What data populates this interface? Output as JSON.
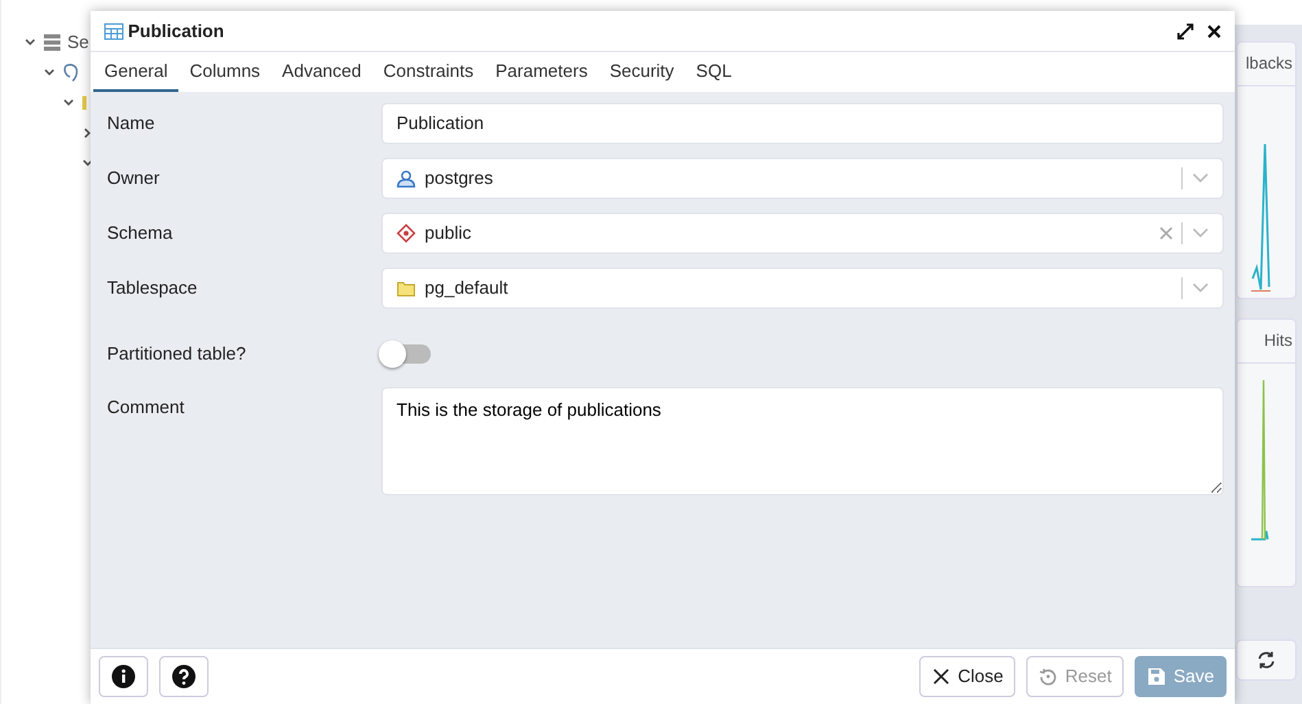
{
  "background": {
    "tree": [
      {
        "label": "Se",
        "expanded": true,
        "children": [
          {
            "expanded": true,
            "children": [
              {
                "expanded": true,
                "children": [
                  {
                    "expanded": false
                  },
                  {
                    "expanded": true
                  }
                ]
              }
            ]
          }
        ]
      }
    ],
    "panels": [
      {
        "title": "lbacks"
      },
      {
        "title": "Hits"
      }
    ]
  },
  "dialog": {
    "title": "Publication",
    "tabs": [
      {
        "label": "General",
        "selected": true
      },
      {
        "label": "Columns",
        "selected": false
      },
      {
        "label": "Advanced",
        "selected": false
      },
      {
        "label": "Constraints",
        "selected": false
      },
      {
        "label": "Parameters",
        "selected": false
      },
      {
        "label": "Security",
        "selected": false
      },
      {
        "label": "SQL",
        "selected": false
      }
    ],
    "fields": [
      {
        "kind": "text",
        "label": "Name",
        "value": "Publication"
      },
      {
        "kind": "role",
        "label": "Owner",
        "value": "postgres",
        "clearable": false
      },
      {
        "kind": "schema",
        "label": "Schema",
        "value": "public",
        "clearable": true
      },
      {
        "kind": "tablespace",
        "label": "Tablespace",
        "value": "pg_default",
        "clearable": false
      },
      {
        "kind": "switch",
        "label": "Partitioned table?",
        "on": false
      },
      {
        "kind": "textarea",
        "label": "Comment",
        "value": "This is the storage of publications"
      }
    ],
    "footer_buttons": [
      {
        "kind": "close",
        "label": "Close",
        "disabled": false
      },
      {
        "kind": "reset",
        "label": "Reset",
        "disabled": true
      },
      {
        "kind": "save",
        "label": "Save",
        "disabled": true
      }
    ]
  }
}
